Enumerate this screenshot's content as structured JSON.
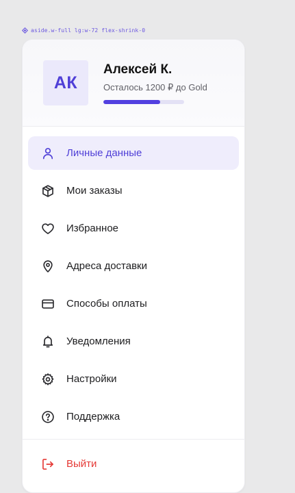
{
  "devtools": {
    "selector": "aside.w-full lg:w-72 flex-shrink-0"
  },
  "profile": {
    "initials": "АК",
    "name": "Алексей К.",
    "loyalty_text": "Осталось 1200 ₽ до Gold",
    "progress_fraction": 0.7,
    "accent": "#5240e0"
  },
  "menu": {
    "items": [
      {
        "label": "Личные данные",
        "icon": "user-icon",
        "active": true
      },
      {
        "label": "Мои заказы",
        "icon": "package-icon",
        "active": false
      },
      {
        "label": "Избранное",
        "icon": "heart-icon",
        "active": false
      },
      {
        "label": "Адреса доставки",
        "icon": "map-pin-icon",
        "active": false
      },
      {
        "label": "Способы оплаты",
        "icon": "credit-card-icon",
        "active": false
      },
      {
        "label": "Уведомления",
        "icon": "bell-icon",
        "active": false
      },
      {
        "label": "Настройки",
        "icon": "gear-icon",
        "active": false
      },
      {
        "label": "Поддержка",
        "icon": "help-circle-icon",
        "active": false
      }
    ],
    "logout": {
      "label": "Выйти",
      "icon": "logout-icon",
      "color": "#e53935"
    }
  }
}
